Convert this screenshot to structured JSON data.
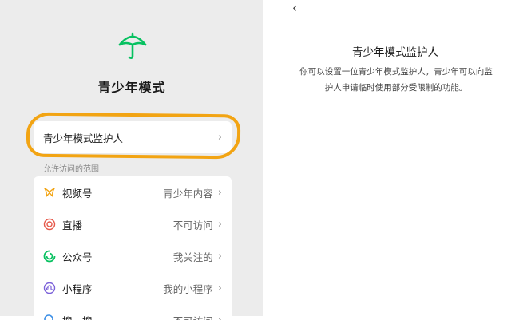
{
  "left": {
    "title": "青少年模式",
    "guardian_row": {
      "label": "青少年模式监护人",
      "chevron": "›"
    },
    "section_label": "允许访问的范围",
    "items": [
      {
        "icon": "video-channel-icon",
        "label": "视频号",
        "value": "青少年内容",
        "chevron": "›"
      },
      {
        "icon": "live-icon",
        "label": "直播",
        "value": "不可访问",
        "chevron": "›"
      },
      {
        "icon": "official-account-icon",
        "label": "公众号",
        "value": "我关注的",
        "chevron": "›"
      },
      {
        "icon": "mini-program-icon",
        "label": "小程序",
        "value": "我的小程序",
        "chevron": "›"
      },
      {
        "icon": "search-icon",
        "label": "搜一搜",
        "value": "不可访问",
        "chevron": "›"
      }
    ]
  },
  "right": {
    "back": "‹",
    "title": "青少年模式监护人",
    "description": "你可以设置一位青少年模式监护人，青少年可以向监护人申请临时使用部分受限制的功能。"
  },
  "colors": {
    "accent_green": "#07c160",
    "highlight_orange": "#f2a413",
    "panel_gray": "#ececec"
  }
}
